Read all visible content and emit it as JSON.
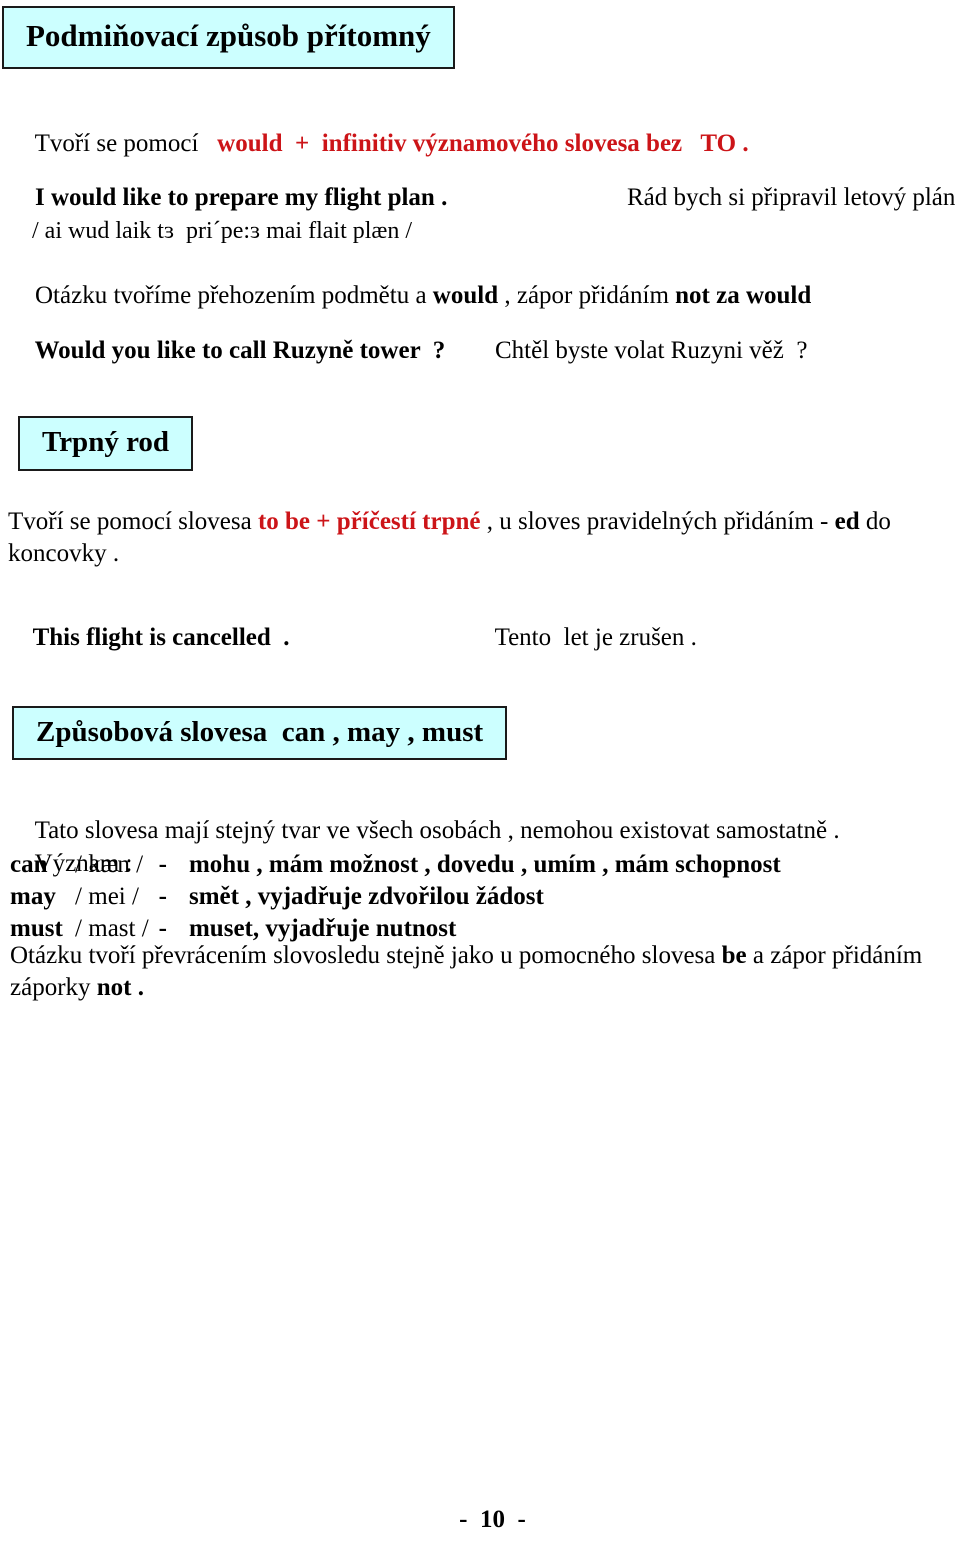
{
  "document": {
    "page_number_label": "-  10  -"
  },
  "sections": {
    "conditional": {
      "heading": "Podmiňovací způsob přítomný",
      "formation": {
        "prefix": "Tvoří se pomocí   ",
        "highlight": "would  +  infinitiv významového slovesa bez   TO ."
      },
      "example_en": "I would like to prepare my flight plan .",
      "example_cs": "Rád bych si připravil letový plán .",
      "example_ipa": "/ ai wud laik tɜ  pri´pe:ɜ mai flait plæn /",
      "question_rule": {
        "part1": "Otázku tvoříme přehozením podmětu a ",
        "bold1": "would",
        "part2": " , zápor přidáním ",
        "bold2": "not za would"
      },
      "question_example_en": "Would you like to call Ruzyně tower  ?",
      "question_example_cs": "Chtěl byste volat Ruzyni věž  ?"
    },
    "passive": {
      "heading": "Trpný rod",
      "rule": {
        "part1": "Tvoří se pomocí slovesa ",
        "red1": "to be",
        "part2": "  +  ",
        "red2": "příčestí trpné",
        "part3": " , u sloves pravidelných přidáním  -  ",
        "bold1": "ed",
        "part4": " do koncovky ."
      },
      "example_en": "This flight is cancelled  .",
      "example_cs": "Tento  let je zrušen ."
    },
    "modals": {
      "heading": "Způsobová slovesa  can , may , must",
      "intro": "Tato slovesa mají stejný tvar ve všech osobách , nemohou existovat samostatně .",
      "meaning_label": "Význam :",
      "table": [
        {
          "verb": "can",
          "ipa": " / kæn /",
          "dash": "-",
          "gloss": "mohu , mám možnost , dovedu , umím , mám schopnost"
        },
        {
          "verb": "may",
          "ipa": " / mei /",
          "dash": "-",
          "gloss": "smět , vyjadřuje zdvořilou žádost"
        },
        {
          "verb": "must",
          "ipa": " / mast /",
          "dash": "-",
          "gloss": "muset, vyjadřuje nutnost"
        }
      ],
      "question_rule": {
        "part1": "Otázku tvoří převrácením slovosledu stejně jako u pomocného slovesa ",
        "bold1": "be",
        "part2": " a zápor přidáním záporky ",
        "bold2": "not",
        "part3": " ."
      }
    }
  },
  "colors": {
    "heading_box_background": "#ccffff",
    "heading_box_border": "#1a1a1a",
    "accent_red": "#cc1418",
    "text": "#000000",
    "page_background": "#ffffff"
  }
}
